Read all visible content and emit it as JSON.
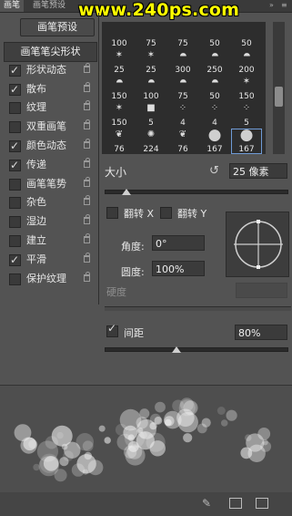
{
  "tabs": [
    {
      "label": "画笔",
      "active": true
    },
    {
      "label": "画笔预设",
      "active": false
    }
  ],
  "watermark": "www.240ps.com",
  "preset_button": "画笔预设",
  "left_items": [
    {
      "label": "画笔笔尖形状",
      "header": true
    },
    {
      "label": "形状动态",
      "checked": true,
      "locked": true
    },
    {
      "label": "散布",
      "checked": true,
      "locked": true
    },
    {
      "label": "纹理",
      "checked": false,
      "locked": true
    },
    {
      "label": "双重画笔",
      "checked": false,
      "locked": true
    },
    {
      "label": "颜色动态",
      "checked": true,
      "locked": true
    },
    {
      "label": "传递",
      "checked": true,
      "locked": true
    },
    {
      "label": "画笔笔势",
      "checked": false,
      "locked": true
    },
    {
      "label": "杂色",
      "checked": false,
      "locked": true
    },
    {
      "label": "湿边",
      "checked": false,
      "locked": true
    },
    {
      "label": "建立",
      "checked": false,
      "locked": true
    },
    {
      "label": "平滑",
      "checked": true,
      "locked": true
    },
    {
      "label": "保护纹理",
      "checked": false,
      "locked": true
    }
  ],
  "brush_rows": [
    [
      {
        "icon": "none",
        "n": "100"
      },
      {
        "icon": "none",
        "n": "75"
      },
      {
        "icon": "none",
        "n": "75"
      },
      {
        "icon": "none",
        "n": "50"
      },
      {
        "icon": "none",
        "n": "50"
      }
    ],
    [
      {
        "icon": "star",
        "n": "25"
      },
      {
        "icon": "star",
        "n": "25"
      },
      {
        "icon": "drop",
        "n": "300"
      },
      {
        "icon": "drop",
        "n": "250"
      },
      {
        "icon": "drop",
        "n": "200"
      }
    ],
    [
      {
        "icon": "drop",
        "n": "150"
      },
      {
        "icon": "drop",
        "n": "100"
      },
      {
        "icon": "drop",
        "n": "75"
      },
      {
        "icon": "drop",
        "n": "50"
      },
      {
        "icon": "star",
        "n": "150"
      }
    ],
    [
      {
        "icon": "star",
        "n": "150"
      },
      {
        "icon": "square",
        "n": "5"
      },
      {
        "icon": "dots",
        "n": "4"
      },
      {
        "icon": "dots",
        "n": "4"
      },
      {
        "icon": "dots",
        "n": "5"
      }
    ],
    [
      {
        "icon": "leaf",
        "n": "76"
      },
      {
        "icon": "splat",
        "n": "224"
      },
      {
        "icon": "leaf",
        "n": "76"
      },
      {
        "icon": "circle",
        "n": "167"
      },
      {
        "icon": "circle",
        "n": "167",
        "selected": true
      }
    ]
  ],
  "size": {
    "label": "大小",
    "value": "25 像素"
  },
  "flip_x": "翻转 X",
  "flip_y": "翻转 Y",
  "angle": {
    "label": "角度:",
    "value": "0°"
  },
  "roundness": {
    "label": "圆度:",
    "value": "100%"
  },
  "hardness": {
    "label": "硬度"
  },
  "spacing": {
    "label": "间距",
    "checked": true,
    "value": "80%"
  }
}
